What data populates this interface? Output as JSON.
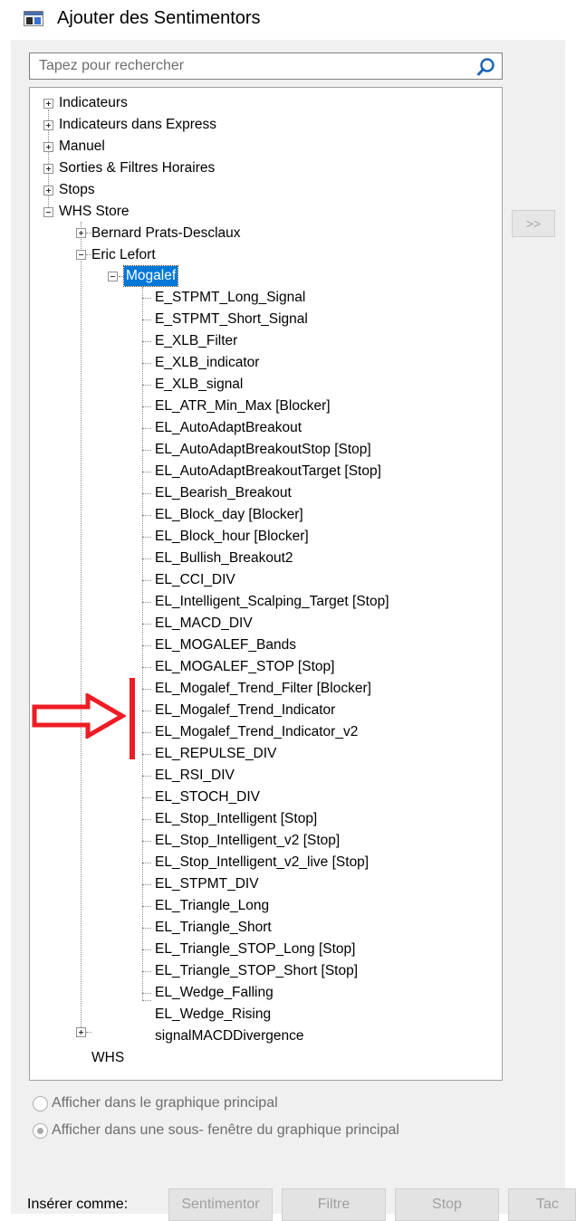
{
  "window": {
    "title": "Ajouter des Sentimentors"
  },
  "search": {
    "placeholder": "Tapez pour rechercher"
  },
  "tree": {
    "items": [
      {
        "label": "Indicateurs"
      },
      {
        "label": "Indicateurs dans Express"
      },
      {
        "label": "Manuel"
      },
      {
        "label": "Sorties & Filtres Horaires"
      },
      {
        "label": "Stops"
      },
      {
        "label": "WHS Store"
      },
      {
        "label": "Bernard Prats-Desclaux"
      },
      {
        "label": "Eric Lefort"
      },
      {
        "label": "Mogalef",
        "selected": true
      },
      {
        "label": "E_STPMT_Long_Signal"
      },
      {
        "label": "E_STPMT_Short_Signal"
      },
      {
        "label": "E_XLB_Filter"
      },
      {
        "label": "E_XLB_indicator"
      },
      {
        "label": "E_XLB_signal"
      },
      {
        "label": "EL_ATR_Min_Max [Blocker]"
      },
      {
        "label": "EL_AutoAdaptBreakout"
      },
      {
        "label": "EL_AutoAdaptBreakoutStop [Stop]"
      },
      {
        "label": "EL_AutoAdaptBreakoutTarget [Stop]"
      },
      {
        "label": "EL_Bearish_Breakout"
      },
      {
        "label": "EL_Block_day [Blocker]"
      },
      {
        "label": "EL_Block_hour [Blocker]"
      },
      {
        "label": "EL_Bullish_Breakout2"
      },
      {
        "label": "EL_CCI_DIV"
      },
      {
        "label": "EL_Intelligent_Scalping_Target [Stop]"
      },
      {
        "label": "EL_MACD_DIV"
      },
      {
        "label": "EL_MOGALEF_Bands"
      },
      {
        "label": "EL_MOGALEF_STOP [Stop]"
      },
      {
        "label": "EL_Mogalef_Trend_Filter [Blocker]"
      },
      {
        "label": "EL_Mogalef_Trend_Indicator"
      },
      {
        "label": "EL_Mogalef_Trend_Indicator_v2"
      },
      {
        "label": "EL_REPULSE_DIV"
      },
      {
        "label": "EL_RSI_DIV"
      },
      {
        "label": "EL_STOCH_DIV"
      },
      {
        "label": "EL_Stop_Intelligent [Stop]"
      },
      {
        "label": "EL_Stop_Intelligent_v2 [Stop]"
      },
      {
        "label": "EL_Stop_Intelligent_v2_live [Stop]"
      },
      {
        "label": "EL_STPMT_DIV"
      },
      {
        "label": "EL_Triangle_Long"
      },
      {
        "label": "EL_Triangle_Short"
      },
      {
        "label": "EL_Triangle_STOP_Long [Stop]"
      },
      {
        "label": "EL_Triangle_STOP_Short [Stop]"
      },
      {
        "label": "EL_Wedge_Falling"
      },
      {
        "label": "EL_Wedge_Rising"
      },
      {
        "label": "signalMACDDivergence"
      },
      {
        "label": "WHS"
      }
    ]
  },
  "add_button": {
    "label": ">>"
  },
  "options": [
    {
      "label": "Afficher dans le graphique principal",
      "checked": false
    },
    {
      "label": "Afficher dans une sous- fenêtre du graphique principal",
      "checked": true
    }
  ],
  "insert": {
    "label": "Insérer comme:",
    "buttons": [
      {
        "label": "Sentimentor"
      },
      {
        "label": "Filtre"
      },
      {
        "label": "Stop"
      },
      {
        "label": "Tac"
      }
    ]
  },
  "colors": {
    "selection": "#0078d7",
    "annotation": "#ee1c24",
    "panel": "#f0f0f0"
  }
}
